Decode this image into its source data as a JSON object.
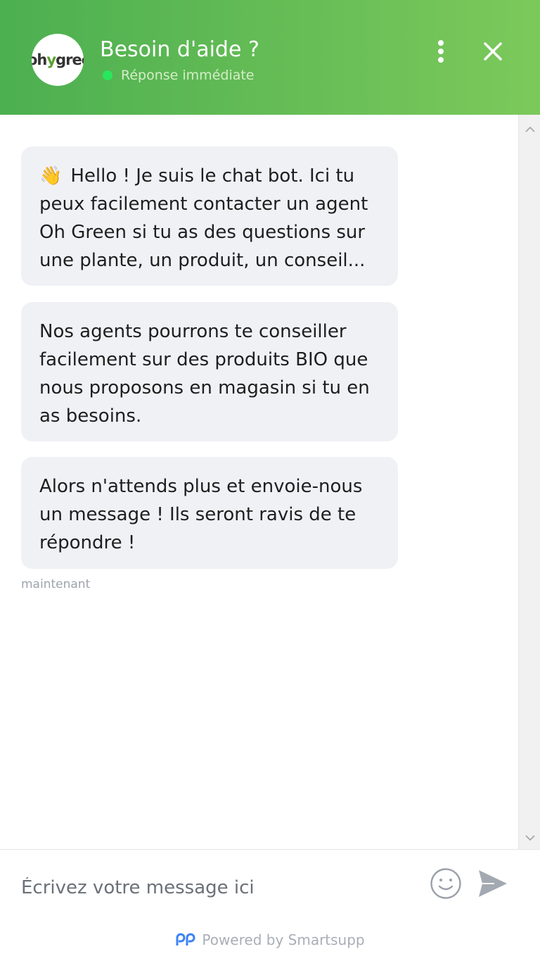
{
  "header": {
    "logo_text_a": "oh",
    "logo_text_b": "y",
    "logo_text_c": "gree",
    "title": "Besoin d'aide ?",
    "status": "Réponse immédiate",
    "status_color": "#27e85c",
    "menu_icon": "more-vertical-icon",
    "close_icon": "close-icon",
    "gradient_start": "#4caf50",
    "gradient_end": "#7cc95b"
  },
  "messages": [
    {
      "emoji": "👋",
      "lines": [
        "Hello ! Je suis le chat bot. Ici tu",
        "peux facilement contacter un agent",
        "Oh Green si tu as des questions sur",
        "une plante, un produit, un conseil..."
      ]
    },
    {
      "lines": [
        "Nos agents pourrons te conseiller",
        "facilement sur des produits BIO que",
        "nous proposons en magasin si tu en",
        "as besoins."
      ]
    },
    {
      "lines": [
        "Alors n'attends plus et envoie-nous",
        "un message ! Ils seront ravis de te",
        "répondre !"
      ]
    }
  ],
  "timestamp": "maintenant",
  "composer": {
    "placeholder": "Écrivez votre message ici",
    "emoji_icon": "smiley-icon",
    "send_icon": "send-icon"
  },
  "footer": {
    "powered_by": "Powered by Smartsupp",
    "brand_color": "#3b82f6"
  }
}
